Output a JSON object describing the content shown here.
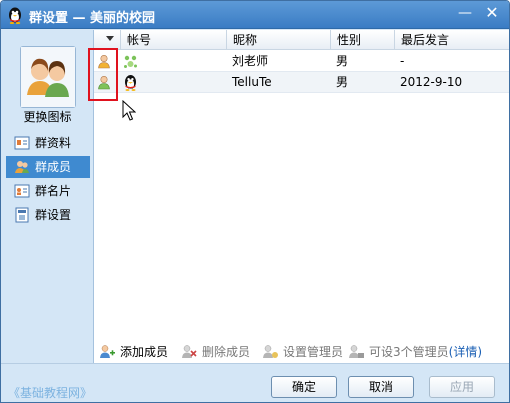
{
  "window": {
    "title": "群设置 — 美丽的校园",
    "minimize_glyph": "—",
    "close_glyph": "✕"
  },
  "sidebar": {
    "change_icon_label": "更换图标",
    "items": [
      {
        "label": "群资料",
        "icon": "group-profile-icon",
        "active": false
      },
      {
        "label": "群成员",
        "icon": "group-members-icon",
        "active": true
      },
      {
        "label": "群名片",
        "icon": "group-card-icon",
        "active": false
      },
      {
        "label": "群设置",
        "icon": "group-settings-icon",
        "active": false
      }
    ]
  },
  "table": {
    "columns": [
      "帐号",
      "昵称",
      "性别",
      "最后发言"
    ],
    "rows": [
      {
        "nickname": "刘老师",
        "gender": "男",
        "last_speak": "-"
      },
      {
        "nickname": "TelluTe",
        "gender": "男",
        "last_speak": "2012-9-10"
      }
    ]
  },
  "actions": {
    "add_member": "添加成员",
    "delete_member": "删除成员",
    "set_admin": "设置管理员",
    "admin_limit": "可设3个管理员",
    "details_link": "(详情)"
  },
  "footer": {
    "watermark": "《基础教程网》",
    "ok": "确定",
    "cancel": "取消",
    "apply": "应用"
  },
  "colors": {
    "titlebar": "#3a7cc4",
    "active_nav": "#3f8ad0",
    "highlight_box": "#e0121e",
    "link": "#1a5fb4"
  }
}
